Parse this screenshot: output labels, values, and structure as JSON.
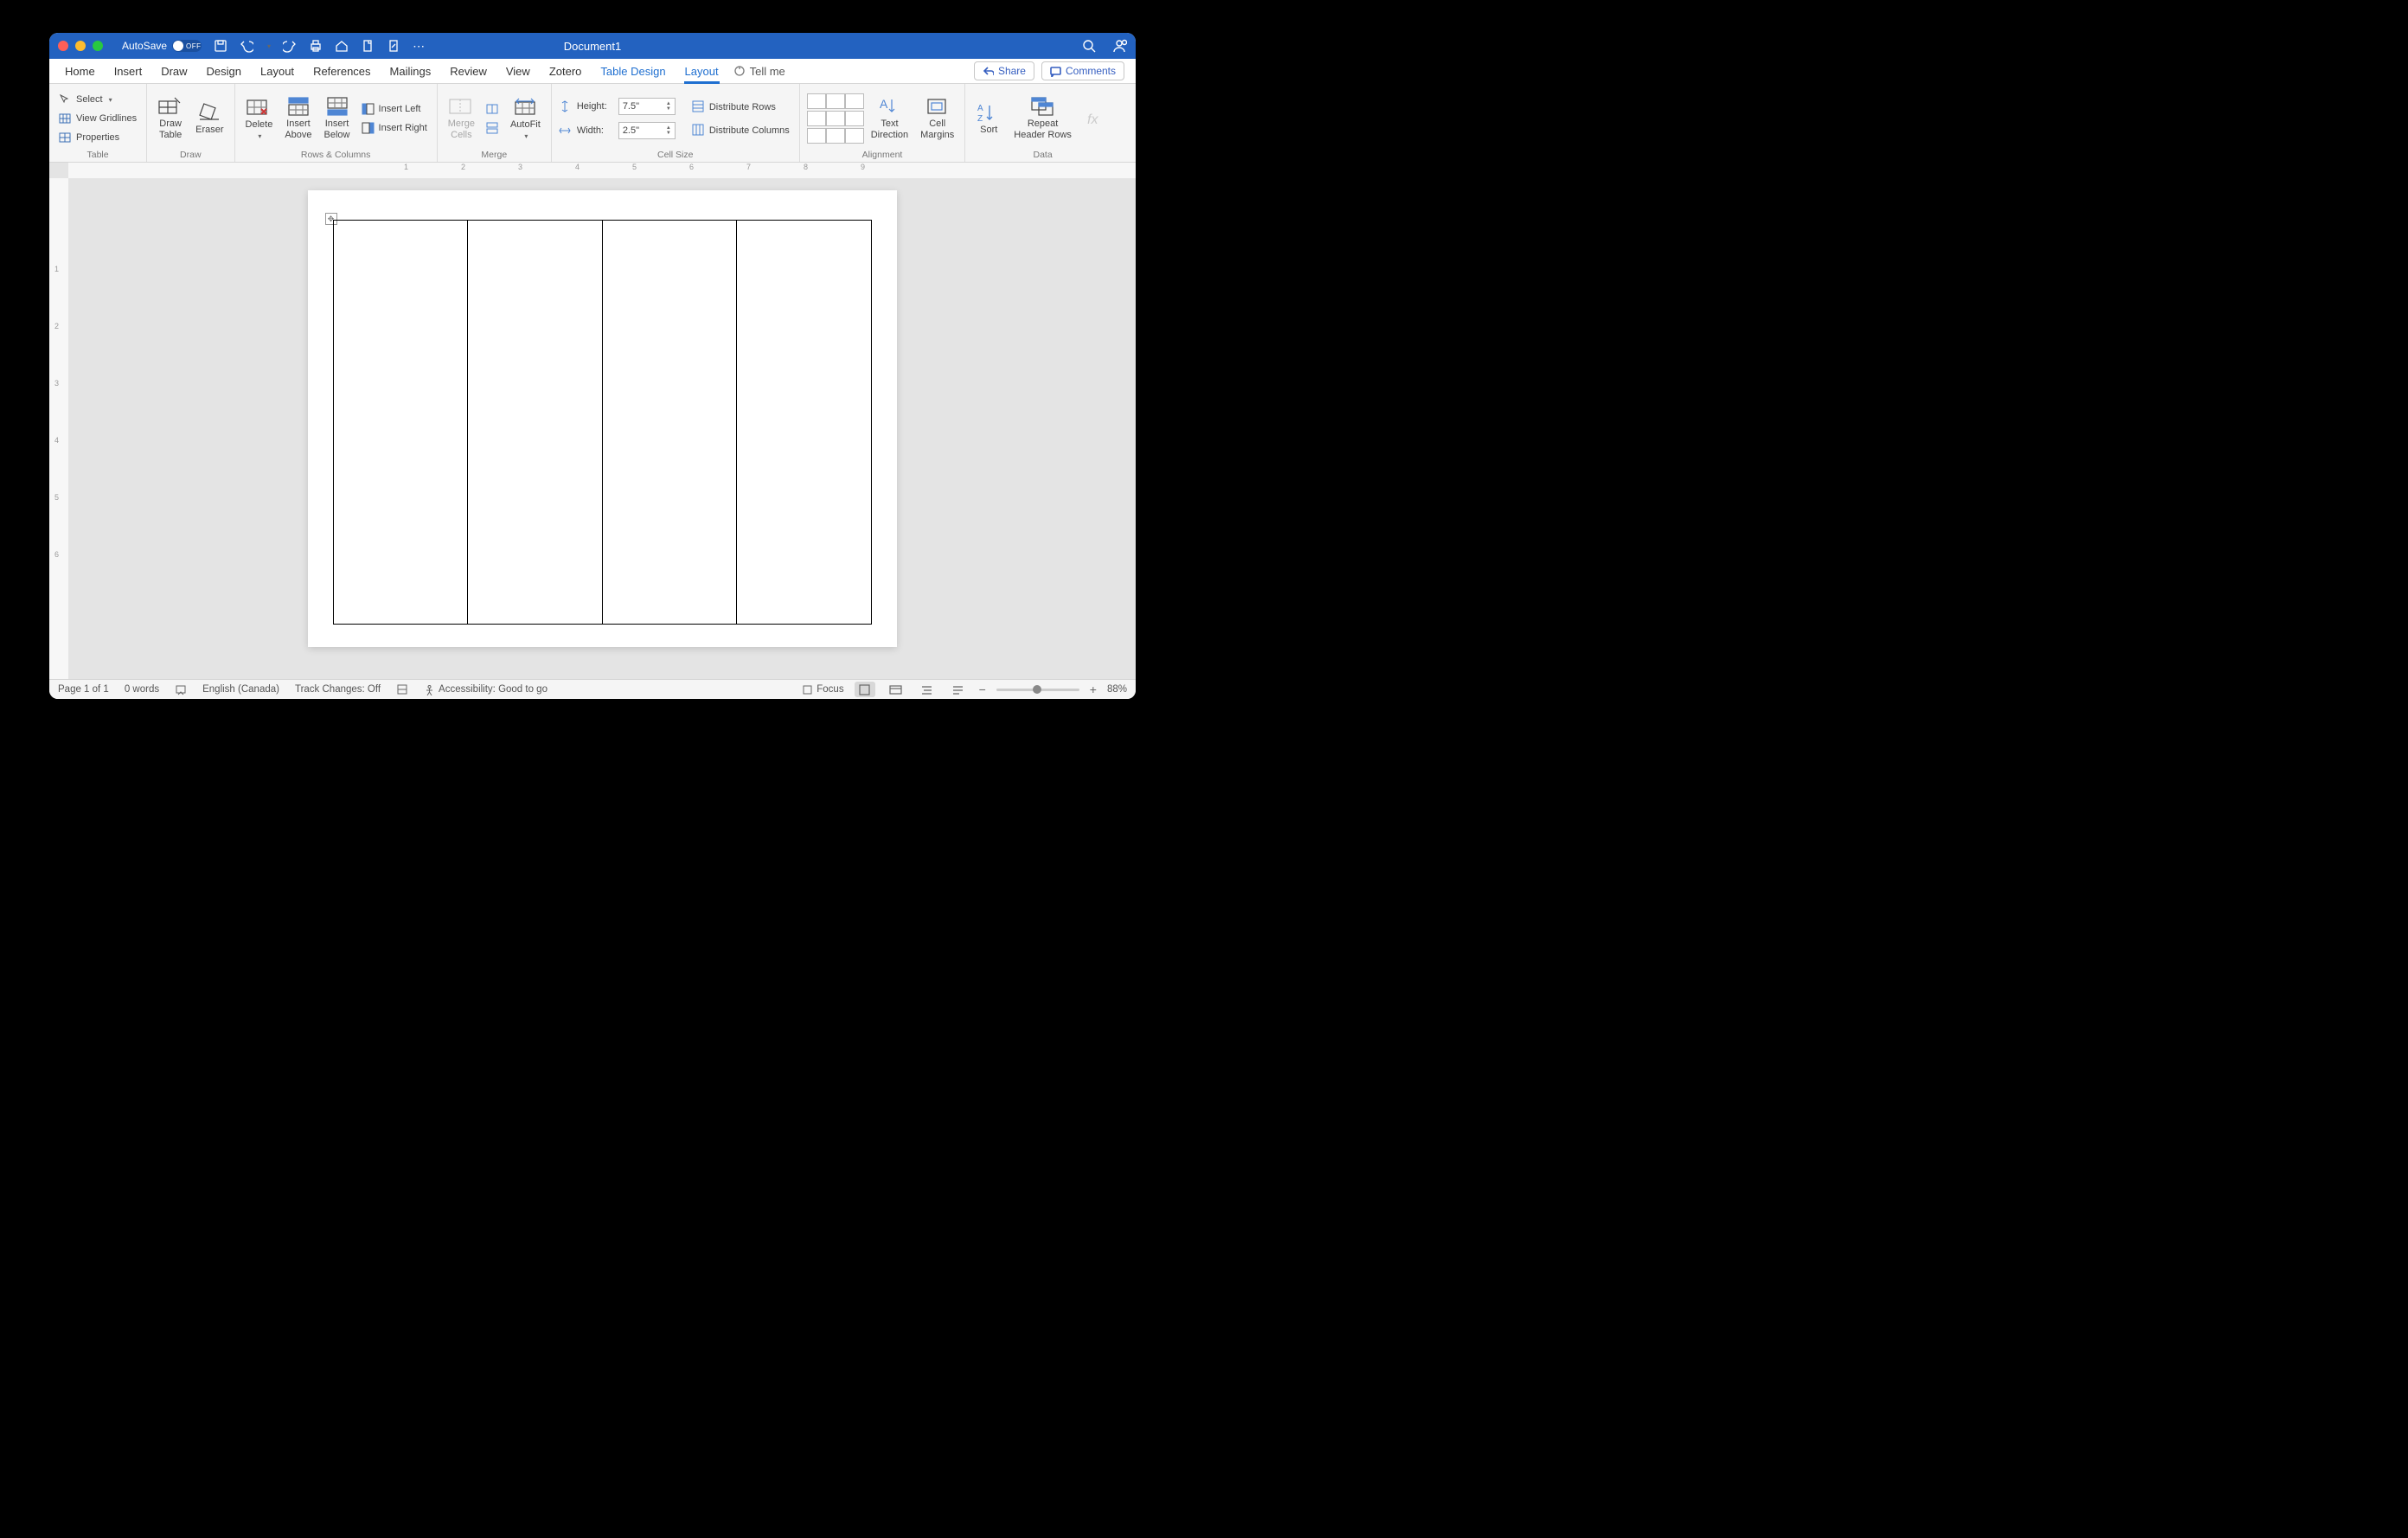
{
  "title": "Document1",
  "autosave": {
    "label": "AutoSave",
    "state": "OFF"
  },
  "tabs": [
    "Home",
    "Insert",
    "Draw",
    "Design",
    "Layout",
    "References",
    "Mailings",
    "Review",
    "View",
    "Zotero",
    "Table Design",
    "Layout"
  ],
  "tellme": "Tell me",
  "share": "Share",
  "comments": "Comments",
  "ribbon": {
    "table": {
      "label": "Table",
      "select": "Select",
      "gridlines": "View Gridlines",
      "properties": "Properties"
    },
    "draw": {
      "label": "Draw",
      "drawtable": "Draw\nTable",
      "eraser": "Eraser"
    },
    "rowscols": {
      "label": "Rows & Columns",
      "delete": "Delete",
      "above": "Insert\nAbove",
      "below": "Insert\nBelow",
      "left": "Insert Left",
      "right": "Insert Right"
    },
    "merge": {
      "label": "Merge",
      "mergecells": "Merge\nCells",
      "split": "",
      "autofit": "AutoFit"
    },
    "cellsize": {
      "label": "Cell Size",
      "height": "Height:",
      "heightval": "7.5\"",
      "width": "Width:",
      "widthval": "2.5\"",
      "distrows": "Distribute Rows",
      "distcols": "Distribute Columns"
    },
    "alignment": {
      "label": "Alignment",
      "textdir": "Text\nDirection",
      "margins": "Cell\nMargins"
    },
    "data": {
      "label": "Data",
      "sort": "Sort",
      "repeat": "Repeat\nHeader Rows",
      "formula": ""
    }
  },
  "ruler_h": [
    "1",
    "2",
    "3",
    "4",
    "5",
    "6",
    "7",
    "8",
    "9"
  ],
  "ruler_v": [
    "1",
    "2",
    "3",
    "4",
    "5",
    "6"
  ],
  "status": {
    "page": "Page 1 of 1",
    "words": "0 words",
    "lang": "English (Canada)",
    "track": "Track Changes: Off",
    "access": "Accessibility: Good to go",
    "focus": "Focus",
    "zoom": "88%"
  }
}
